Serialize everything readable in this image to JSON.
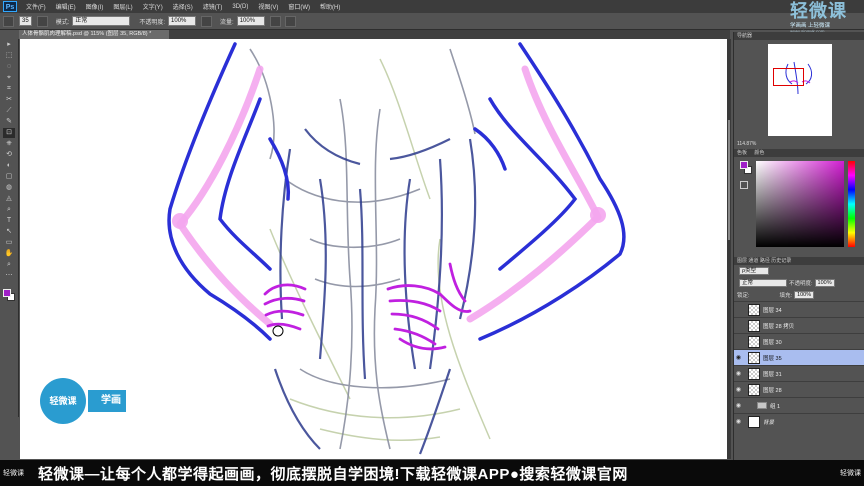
{
  "app": {
    "logo": "Ps",
    "menu": [
      "文件(F)",
      "编辑(E)",
      "图像(I)",
      "图层(L)",
      "文字(Y)",
      "选择(S)",
      "滤镜(T)",
      "3D(D)",
      "视图(V)",
      "窗口(W)",
      "帮助(H)"
    ],
    "window_controls": [
      "—",
      "□",
      "✕"
    ]
  },
  "options_bar": {
    "brush_size": "35",
    "mode_label": "模式:",
    "mode_value": "正常",
    "opacity_label": "不透明度:",
    "opacity_value": "100%",
    "flow_label": "流量:",
    "flow_value": "100%"
  },
  "document": {
    "tab_title": "人体骨骼肌肉理解稿.psd @ 115% (图层 35, RGB/8) *",
    "close": "×"
  },
  "toolbar": {
    "tools": [
      "▸",
      "⬚",
      "◌",
      "⌖",
      "⌗",
      "✂",
      "⟋",
      "✎",
      "⊡",
      "⎈",
      "⟲",
      "◐",
      "▢",
      "◍",
      "◬",
      "⌕",
      "T",
      "↖",
      "▭",
      "✋",
      "⌕",
      "⋯"
    ]
  },
  "navigator": {
    "tabs": [
      "导航器"
    ],
    "zoom": "114.87%"
  },
  "color_panel": {
    "tabs": [
      "色板",
      "颜色"
    ],
    "foreground": "#a020c8",
    "background": "#ffffff"
  },
  "layers_panel": {
    "tabs": [
      "图层",
      "通道",
      "路径",
      "历史记录"
    ],
    "filter_label": "ρ类型",
    "blend_mode": "正常",
    "opacity_label": "不透明度:",
    "opacity_value": "100%",
    "lock_label": "锁定:",
    "fill_label": "填充:",
    "fill_value": "100%",
    "layers": [
      {
        "name": "图层 34",
        "visible": false,
        "selected": false
      },
      {
        "name": "图层 28 拷贝",
        "visible": false,
        "selected": false
      },
      {
        "name": "图层 30",
        "visible": false,
        "selected": false
      },
      {
        "name": "图层 35",
        "visible": true,
        "selected": true
      },
      {
        "name": "图层 31",
        "visible": true,
        "selected": false
      },
      {
        "name": "图层 28",
        "visible": true,
        "selected": false
      }
    ],
    "group": {
      "name": "组 1",
      "visible": true
    },
    "background_layer": {
      "name": "背景",
      "visible": true
    }
  },
  "watermark": {
    "title": "轻微课",
    "subtitle": "学画画 上轻微课",
    "url": "www.qingwk.com"
  },
  "badge": {
    "logo_text": "轻微课",
    "tag_text": "学画"
  },
  "banner": {
    "logo": "轻微课",
    "text": "轻微课—让每个人都学得起画画，彻底摆脱自学困境!下载轻微课APP●搜索轻微课官网",
    "logo_right": "轻微课"
  }
}
